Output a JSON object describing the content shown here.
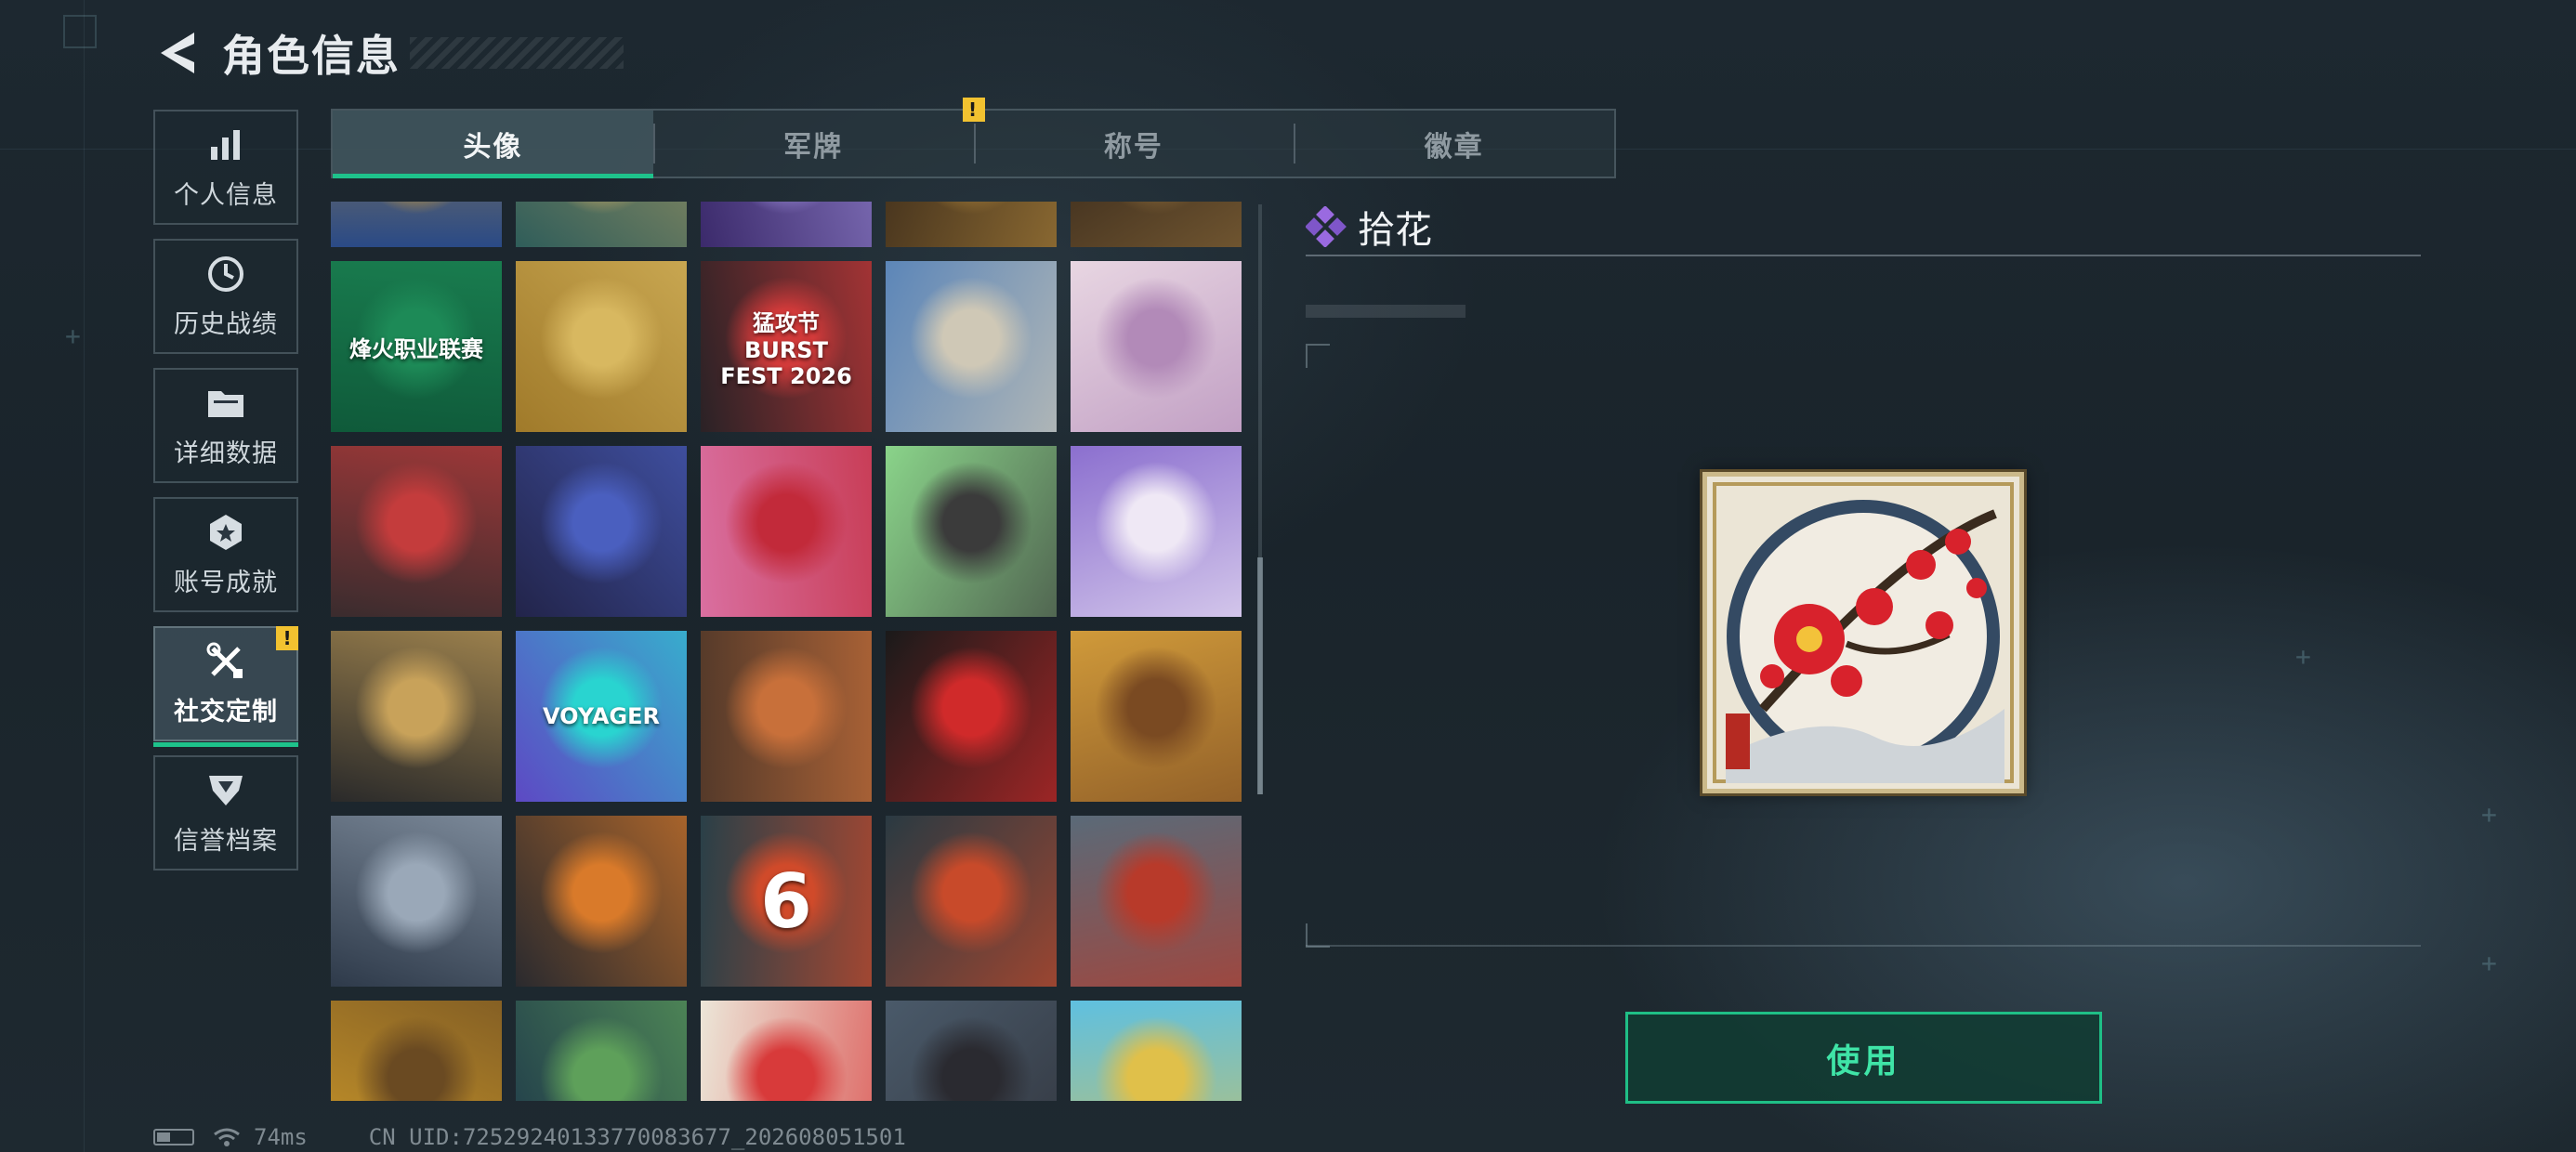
{
  "header": {
    "title": "角色信息"
  },
  "nav": {
    "items": [
      {
        "label": "个人信息",
        "icon": "bar-chart-icon",
        "active": false,
        "badge": ""
      },
      {
        "label": "历史战绩",
        "icon": "clock-history-icon",
        "active": false,
        "badge": ""
      },
      {
        "label": "详细数据",
        "icon": "folder-icon",
        "active": false,
        "badge": ""
      },
      {
        "label": "账号成就",
        "icon": "medal-icon",
        "active": false,
        "badge": ""
      },
      {
        "label": "社交定制",
        "icon": "wrench-screwdriver-icon",
        "active": true,
        "badge": "!"
      },
      {
        "label": "信誉档案",
        "icon": "shield-icon",
        "active": false,
        "badge": ""
      }
    ]
  },
  "tabs": {
    "items": [
      {
        "label": "头像",
        "active": true,
        "badge": ""
      },
      {
        "label": "军牌",
        "active": false,
        "badge": "!"
      },
      {
        "label": "称号",
        "active": false,
        "badge": ""
      },
      {
        "label": "徽章",
        "active": false,
        "badge": ""
      }
    ]
  },
  "avatars": [
    {
      "name": "avatar-blue-dragon",
      "colors": [
        "#2a4a86",
        "#c99a3a"
      ]
    },
    {
      "name": "avatar-teal-gold-ornament",
      "colors": [
        "#2f5d5a",
        "#c7a866"
      ]
    },
    {
      "name": "avatar-purple-neon",
      "colors": [
        "#3b2a6b",
        "#9c8cd8"
      ]
    },
    {
      "name": "avatar-dark-soldier-gold",
      "colors": [
        "#3a2a1a",
        "#a8803a"
      ]
    },
    {
      "name": "avatar-dark-soldier-brown",
      "colors": [
        "#2a1e16",
        "#8a6a3a"
      ]
    },
    {
      "name": "avatar-league-green",
      "colors": [
        "#0f5a3a",
        "#1d8a57"
      ],
      "text": "烽火职业联赛"
    },
    {
      "name": "avatar-gold-robot-peace",
      "colors": [
        "#a07a2a",
        "#d8b860"
      ]
    },
    {
      "name": "avatar-burst-fest",
      "colors": [
        "#2a2226",
        "#d23a3a"
      ],
      "text": "猛攻节 BURST FEST 2026"
    },
    {
      "name": "avatar-soldier-football",
      "colors": [
        "#5c86b8",
        "#cfc8b6"
      ]
    },
    {
      "name": "avatar-anime-girl-silver",
      "colors": [
        "#e8d6e2",
        "#b28ab8"
      ]
    },
    {
      "name": "avatar-red-mask-soldier",
      "colors": [
        "#3a2c2e",
        "#c43c3c"
      ]
    },
    {
      "name": "avatar-neon-hacker",
      "colors": [
        "#22244a",
        "#4a5fbf"
      ]
    },
    {
      "name": "avatar-skull-roses",
      "colors": [
        "#d96fa0",
        "#c22a3a"
      ]
    },
    {
      "name": "avatar-duck-helmet-kid",
      "colors": [
        "#8ad48a",
        "#3b3b3b"
      ]
    },
    {
      "name": "avatar-cat-ear-chibi",
      "colors": [
        "#8b6fcf",
        "#efe8f5"
      ]
    },
    {
      "name": "avatar-gold-triangle-emblem",
      "colors": [
        "#2a2a2a",
        "#c8a25a"
      ]
    },
    {
      "name": "avatar-voyager-graffiti",
      "colors": [
        "#5d49c4",
        "#29d4d0"
      ],
      "text": "VOYAGER"
    },
    {
      "name": "avatar-bearded-soldier",
      "colors": [
        "#553a2a",
        "#c8703a"
      ]
    },
    {
      "name": "avatar-suit-man",
      "colors": [
        "#1a1a1a",
        "#d02a2a"
      ]
    },
    {
      "name": "avatar-horse-girl",
      "colors": [
        "#d09a3a",
        "#7a4a22"
      ]
    },
    {
      "name": "avatar-armored-squad",
      "colors": [
        "#2e3a4a",
        "#9aa8b8"
      ]
    },
    {
      "name": "avatar-crossed-rifles",
      "colors": [
        "#2a2a2e",
        "#d97a2a"
      ]
    },
    {
      "name": "avatar-rank-six-shield",
      "colors": [
        "#2a4048",
        "#d04a2a"
      ],
      "text": "6"
    },
    {
      "name": "avatar-crossed-swords",
      "colors": [
        "#2a3a42",
        "#c84a2a"
      ]
    },
    {
      "name": "avatar-rook-tower",
      "colors": [
        "#5a6a78",
        "#b83a2a"
      ]
    },
    {
      "name": "avatar-yellow-mech",
      "colors": [
        "#c8962a",
        "#6a4a22"
      ]
    },
    {
      "name": "avatar-helmet-soldier-green",
      "colors": [
        "#1f3a4a",
        "#5ea05a"
      ]
    },
    {
      "name": "avatar-plum-blossom",
      "colors": [
        "#ece6d8",
        "#d83a3a"
      ],
      "selected": true
    },
    {
      "name": "avatar-gunner-desert",
      "colors": [
        "#4a5a6a",
        "#2a2a30"
      ]
    },
    {
      "name": "avatar-blue-globe",
      "colors": [
        "#5fc0e0",
        "#e0c04a"
      ]
    }
  ],
  "detail": {
    "name": "拾花",
    "icon": "purple-diamond-icon",
    "preview": "plum-blossom-avatar",
    "use_label": "使用"
  },
  "status": {
    "ping": "74ms",
    "uid": "CN UID:7252924013377008367​7_202608051501"
  },
  "colors": {
    "accent": "#1ec28b",
    "badge": "#f2c230"
  }
}
